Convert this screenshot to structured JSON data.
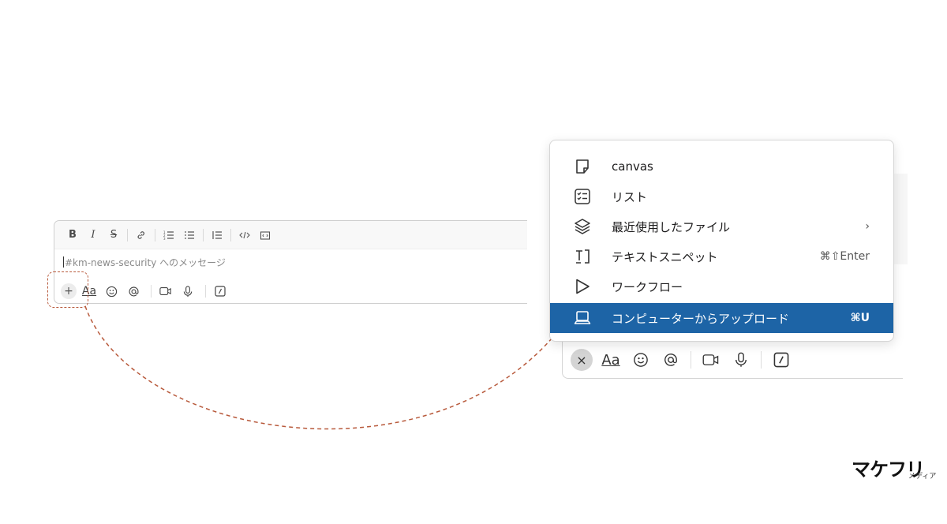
{
  "left_composer": {
    "format_buttons": [
      "B",
      "I",
      "S"
    ],
    "placeholder": "#km-news-security へのメッセージ",
    "aa_label": "Aa",
    "plus_label": "+"
  },
  "right_composer": {
    "aa_label": "Aa",
    "close_label": "×"
  },
  "menu": {
    "items": [
      {
        "label": "canvas",
        "icon": "canvas-icon",
        "right": ""
      },
      {
        "label": "リスト",
        "icon": "list-icon",
        "right": ""
      },
      {
        "label": "最近使用したファイル",
        "icon": "layers-icon",
        "right": "›"
      },
      {
        "label": "テキストスニペット",
        "icon": "snippet-icon",
        "right": "⌘⇧Enter"
      },
      {
        "label": "ワークフロー",
        "icon": "play-icon",
        "right": ""
      },
      {
        "label": "コンピューターからアップロード",
        "icon": "laptop-icon",
        "right": "⌘U",
        "active": true
      }
    ]
  },
  "logo": {
    "main": "マケフリ",
    "sub": "メディア"
  },
  "colors": {
    "accent": "#1d64a6",
    "annotation": "#b85a3c"
  }
}
